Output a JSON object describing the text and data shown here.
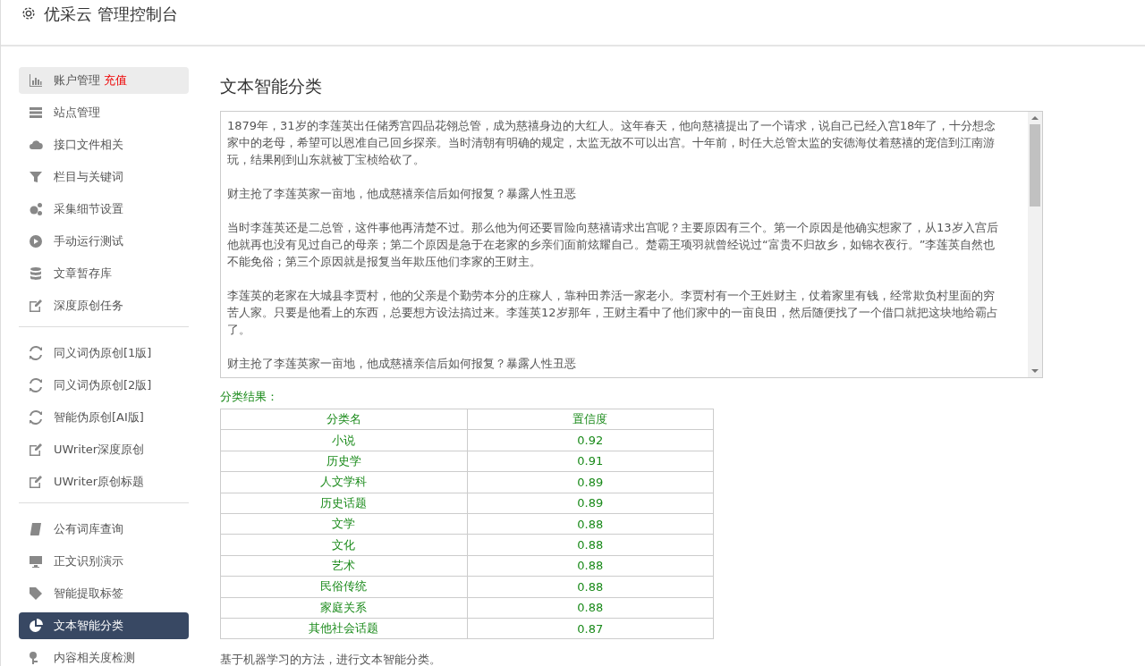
{
  "header": {
    "title": "优采云 管理控制台"
  },
  "sidebar": {
    "groups": [
      {
        "items": [
          {
            "label": "账户管理",
            "badge": "充值",
            "selected": false,
            "highlighted": true
          },
          {
            "label": "站点管理",
            "selected": false,
            "highlighted": false
          },
          {
            "label": "接口文件相关",
            "selected": false,
            "highlighted": false
          },
          {
            "label": "栏目与关键词",
            "selected": false,
            "highlighted": false
          },
          {
            "label": "采集细节设置",
            "selected": false,
            "highlighted": false
          },
          {
            "label": "手动运行测试",
            "selected": false,
            "highlighted": false
          },
          {
            "label": "文章暂存库",
            "selected": false,
            "highlighted": false
          },
          {
            "label": "深度原创任务",
            "selected": false,
            "highlighted": false
          }
        ]
      },
      {
        "items": [
          {
            "label": "同义词伪原创[1版]",
            "selected": false,
            "highlighted": false
          },
          {
            "label": "同义词伪原创[2版]",
            "selected": false,
            "highlighted": false
          },
          {
            "label": "智能伪原创[AI版]",
            "selected": false,
            "highlighted": false
          },
          {
            "label": "UWriter深度原创",
            "selected": false,
            "highlighted": false
          },
          {
            "label": "UWriter原创标题",
            "selected": false,
            "highlighted": false
          }
        ]
      },
      {
        "items": [
          {
            "label": "公有词库查询",
            "selected": false,
            "highlighted": false
          },
          {
            "label": "正文识别演示",
            "selected": false,
            "highlighted": false
          },
          {
            "label": "智能提取标签",
            "selected": false,
            "highlighted": false
          },
          {
            "label": "文本智能分类",
            "selected": true,
            "highlighted": false
          },
          {
            "label": "内容相关度检测",
            "selected": false,
            "highlighted": false
          }
        ]
      }
    ]
  },
  "main": {
    "title": "文本智能分类",
    "text_input": {
      "paragraphs": [
        "1879年，31岁的李莲英出任储秀宫四品花翎总管，成为慈禧身边的大红人。这年春天，他向慈禧提出了一个请求，说自己已经入宫18年了，十分想念家中的老母，希望可以恩准自己回乡探亲。当时清朝有明确的规定，太监无故不可以出宫。十年前，时任大总管太监的安德海仗着慈禧的宠信到江南游玩，结果刚到山东就被丁宝桢给砍了。",
        "财主抢了李莲英家一亩地，他成慈禧亲信后如何报复？暴露人性丑恶",
        "当时李莲英还是二总管，这件事他再清楚不过。那么他为何还要冒险向慈禧请求出宫呢？主要原因有三个。第一个原因是他确实想家了，从13岁入宫后他就再也没有见过自己的母亲；第二个原因是急于在老家的乡亲们面前炫耀自己。楚霸王项羽就曾经说过“富贵不归故乡，如锦衣夜行。”李莲英自然也不能免俗；第三个原因就是报复当年欺压他们李家的王财主。",
        "李莲英的老家在大城县李贾村，他的父亲是个勤劳本分的庄稼人，靠种田养活一家老小。李贾村有一个王姓财主，仗着家里有钱，经常欺负村里面的穷苦人家。只要是他看上的东西，总要想方设法搞过来。李莲英12岁那年，王财主看中了他们家中的一亩良田，然后随便找了一个借口就把这块地给霸占了。",
        "财主抢了李莲英家一亩地，他成慈禧亲信后如何报复？暴露人性丑恶"
      ]
    },
    "result_label": "分类结果：",
    "table": {
      "columns": [
        "分类名",
        "置信度"
      ],
      "rows": [
        [
          "小说",
          "0.92"
        ],
        [
          "历史学",
          "0.91"
        ],
        [
          "人文学科",
          "0.89"
        ],
        [
          "历史话题",
          "0.89"
        ],
        [
          "文学",
          "0.88"
        ],
        [
          "文化",
          "0.88"
        ],
        [
          "艺术",
          "0.88"
        ],
        [
          "民俗传统",
          "0.88"
        ],
        [
          "家庭关系",
          "0.88"
        ],
        [
          "其他社会话题",
          "0.87"
        ]
      ]
    },
    "footnote": "基于机器学习的方法，进行文本智能分类。"
  }
}
